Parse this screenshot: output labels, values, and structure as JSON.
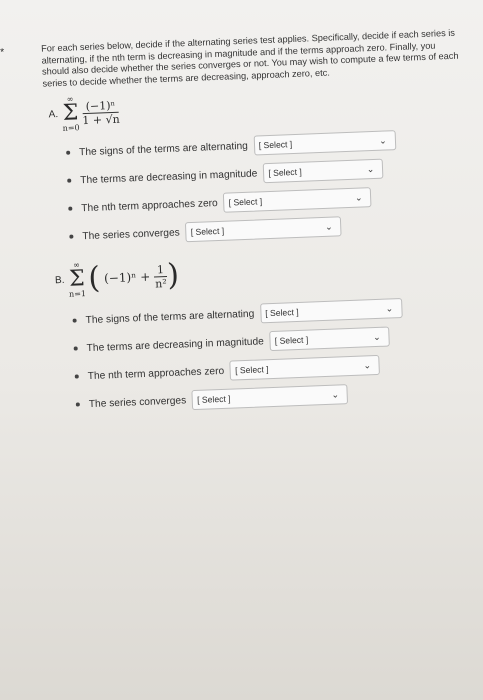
{
  "star": "*",
  "intro": "For each series below, decide if the alternating series test applies. Specifically, decide if each series is alternating, if the nth term is decreasing in magnitude and if the terms approach zero. Finally, you should also decide whether the series converges or not. You may wish to compute a few terms of each series to decide whether the terms are decreasing, approach zero, etc.",
  "partA": {
    "label": "A.",
    "sum_top": "∞",
    "sum_bottom": "n=0",
    "numerator": "(−1)ⁿ",
    "denominator": "1 + √n",
    "rows": [
      {
        "text": "The signs of the terms are alternating",
        "select": "[ Select ]"
      },
      {
        "text": "The terms are decreasing in magnitude",
        "select": "[ Select ]"
      },
      {
        "text": "The nth term approaches zero",
        "select": "[ Select ]"
      },
      {
        "text": "The series converges",
        "select": "[ Select ]"
      }
    ]
  },
  "partB": {
    "label": "B.",
    "sum_top": "∞",
    "sum_bottom": "n=1",
    "term": "(−1)ⁿ +",
    "numerator": "1",
    "denominator": "n²",
    "rows": [
      {
        "text": "The signs of the terms are alternating",
        "select": "[ Select ]"
      },
      {
        "text": "The terms are decreasing in magnitude",
        "select": "[ Select ]"
      },
      {
        "text": "The nth term approaches zero",
        "select": "[ Select ]"
      },
      {
        "text": "The series converges",
        "select": "[ Select ]"
      }
    ]
  },
  "icons": {
    "chevron": "chevron-down-icon"
  }
}
